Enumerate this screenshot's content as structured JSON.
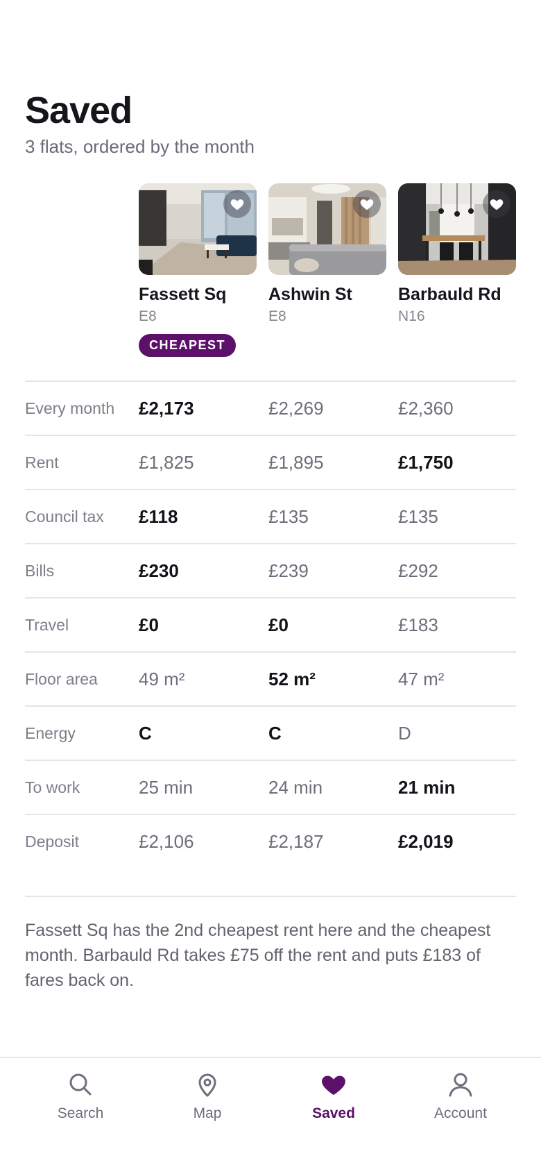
{
  "header": {
    "title": "Saved",
    "subtitle": "3 flats, ordered by the month"
  },
  "flats": [
    {
      "name": "Fassett Sq",
      "area": "E8",
      "badge": "CHEAPEST"
    },
    {
      "name": "Ashwin St",
      "area": "E8"
    },
    {
      "name": "Barbauld Rd",
      "area": "N16"
    }
  ],
  "comparison": {
    "rows": [
      {
        "label": "Every month",
        "values": [
          "£2,173",
          "£2,269",
          "£2,360"
        ],
        "best": [
          true,
          false,
          false
        ]
      },
      {
        "label": "Rent",
        "values": [
          "£1,825",
          "£1,895",
          "£1,750"
        ],
        "best": [
          false,
          false,
          true
        ]
      },
      {
        "label": "Council tax",
        "values": [
          "£118",
          "£135",
          "£135"
        ],
        "best": [
          true,
          false,
          false
        ]
      },
      {
        "label": "Bills",
        "values": [
          "£230",
          "£239",
          "£292"
        ],
        "best": [
          true,
          false,
          false
        ]
      },
      {
        "label": "Travel",
        "values": [
          "£0",
          "£0",
          "£183"
        ],
        "best": [
          true,
          true,
          false
        ]
      },
      {
        "label": "Floor area",
        "values": [
          "49 m²",
          "52 m²",
          "47 m²"
        ],
        "best": [
          false,
          true,
          false
        ]
      },
      {
        "label": "Energy",
        "values": [
          "C",
          "C",
          "D"
        ],
        "best": [
          true,
          true,
          false
        ]
      },
      {
        "label": "To work",
        "values": [
          "25 min",
          "24 min",
          "21 min"
        ],
        "best": [
          false,
          false,
          true
        ]
      },
      {
        "label": "Deposit",
        "values": [
          "£2,106",
          "£2,187",
          "£2,019"
        ],
        "best": [
          false,
          false,
          true
        ]
      }
    ]
  },
  "summary": "Fassett Sq has the 2nd cheapest rent here and the cheapest month. Barbauld Rd takes £75 off the rent and puts £183 of fares back on.",
  "tabbar": {
    "tabs": [
      {
        "label": "Search",
        "icon": "search-icon",
        "active": false
      },
      {
        "label": "Map",
        "icon": "map-pin-icon",
        "active": false
      },
      {
        "label": "Saved",
        "icon": "heart-icon",
        "active": true
      },
      {
        "label": "Account",
        "icon": "user-icon",
        "active": false
      }
    ]
  },
  "colors": {
    "accent": "#5c1069",
    "text": "#16161d",
    "muted": "#6e6e7b",
    "divider": "#e4e4ea"
  }
}
